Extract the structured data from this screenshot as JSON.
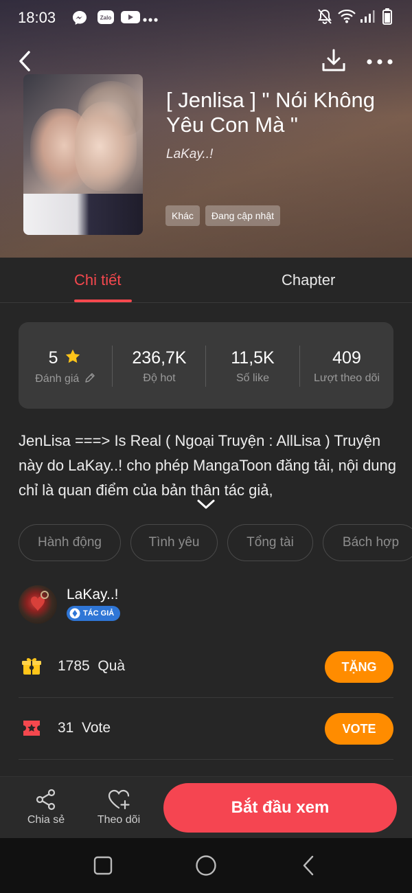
{
  "status_bar": {
    "time": "18:03",
    "zalo": "Zalo"
  },
  "header": {
    "title": "[ Jenlisa ] \" Nói Không Yêu Con Mà \"",
    "author": "LaKay..!",
    "tags": [
      "Khác",
      "Đang cập nhật"
    ]
  },
  "tabs": {
    "detail": "Chi tiết",
    "chapter": "Chapter",
    "active": "detail"
  },
  "stats": [
    {
      "value": "5",
      "label": "Đánh giá"
    },
    {
      "value": "236,7K",
      "label": "Độ hot"
    },
    {
      "value": "11,5K",
      "label": "Số like"
    },
    {
      "value": "409",
      "label": "Lượt theo dõi"
    }
  ],
  "description": "JenLisa ===> Is Real ( Ngoại Truyện : AllLisa ) Truyện này do LaKay..! cho phép MangaToon đăng tải, nội dung chỉ là quan điểm của bản thân tác giả,",
  "genres": [
    "Hành động",
    "Tình yêu",
    "Tổng tài",
    "Bách hợp"
  ],
  "author_card": {
    "name": "LaKay..!",
    "badge": "TÁC GIẢ"
  },
  "gift": {
    "count": "1785",
    "label": "Quà",
    "button": "TẶNG"
  },
  "vote": {
    "count": "31",
    "label": "Vote",
    "button": "VOTE"
  },
  "bottom_bar": {
    "share": "Chia sẻ",
    "follow": "Theo dõi",
    "start": "Bắt đầu xem"
  },
  "colors": {
    "accent": "#f5484e",
    "orange": "#ff8c00",
    "badge": "#2f76d6",
    "background": "#262626"
  }
}
